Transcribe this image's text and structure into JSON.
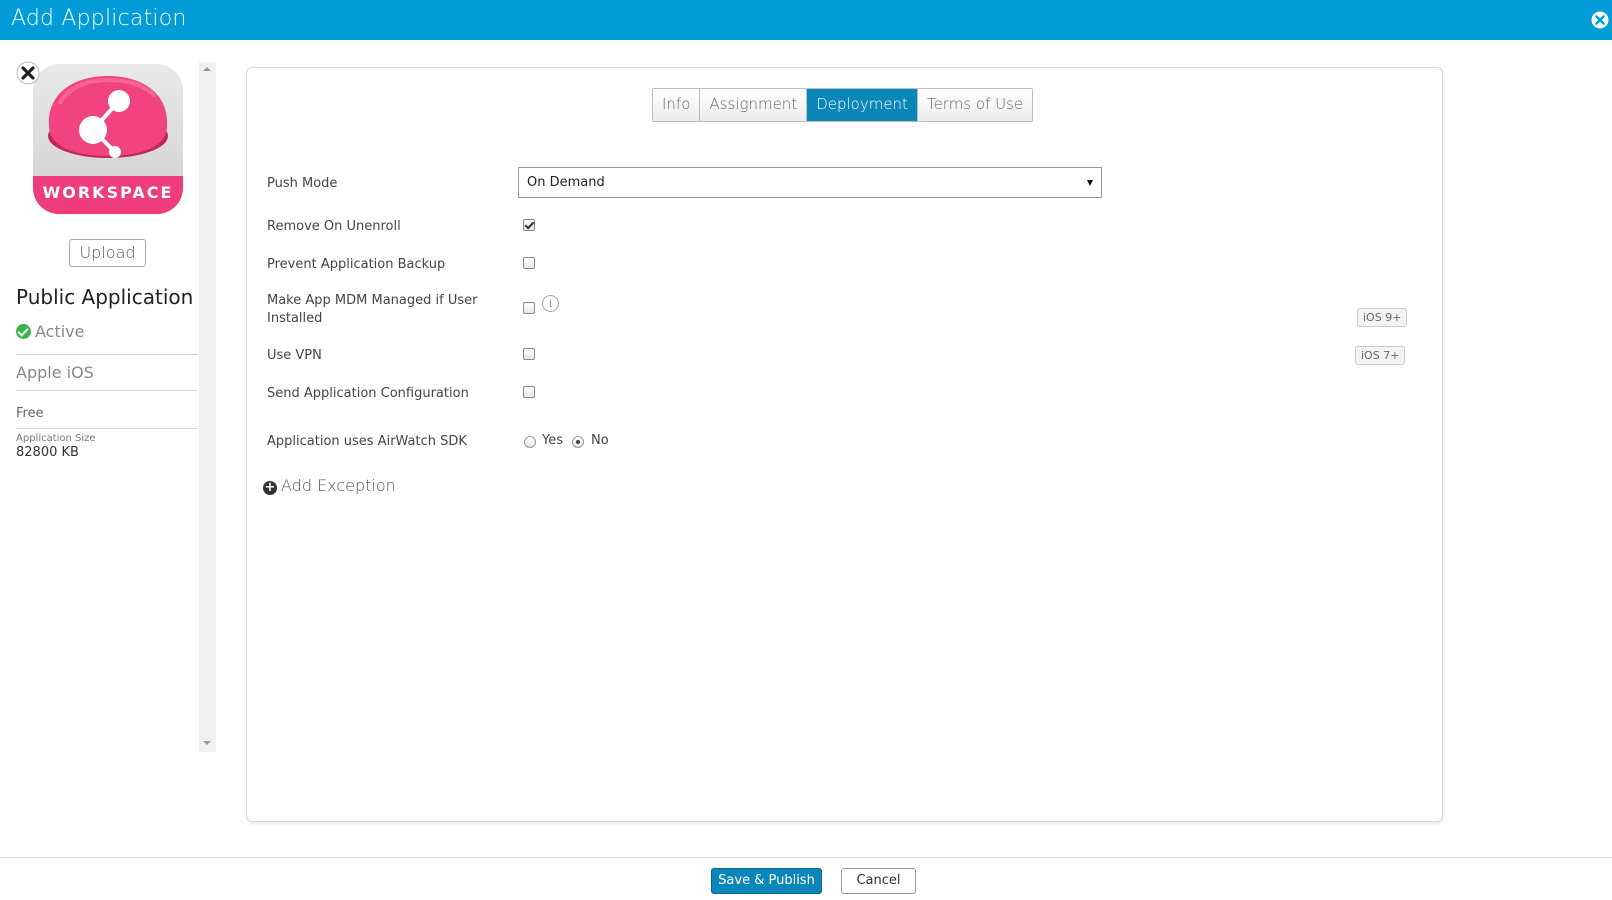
{
  "window": {
    "title": "Add Application",
    "accent_color": "#009cd8",
    "close_icon": "close-circle-icon"
  },
  "sidebar": {
    "app_icon_text": "WORKSPACE",
    "remove_icon": "remove-icon",
    "upload_label": "Upload",
    "app_type": "Public Application",
    "status": "Active",
    "status_color": "#3cb34a",
    "platform": "Apple iOS",
    "price": "Free",
    "size_label": "Application Size",
    "size_value": "82800 KB"
  },
  "tabs": [
    {
      "label": "Info",
      "active": false
    },
    {
      "label": "Assignment",
      "active": false
    },
    {
      "label": "Deployment",
      "active": true
    },
    {
      "label": "Terms of Use",
      "active": false
    }
  ],
  "form": {
    "push_mode": {
      "label": "Push Mode",
      "value": "On Demand"
    },
    "remove_on_unenroll": {
      "label": "Remove On Unenroll",
      "checked": true
    },
    "prevent_backup": {
      "label": "Prevent Application Backup",
      "checked": false
    },
    "mdm_managed": {
      "label_line1": "Make App MDM Managed if User",
      "label_line2": "Installed",
      "checked": false,
      "badge": "iOS 9+"
    },
    "use_vpn": {
      "label": "Use VPN",
      "checked": false,
      "badge": "iOS 7+"
    },
    "send_config": {
      "label": "Send Application Configuration",
      "checked": false
    },
    "airwatch_sdk": {
      "label": "Application uses AirWatch SDK",
      "options": [
        "Yes",
        "No"
      ],
      "selected": "No"
    },
    "add_exception": "Add Exception"
  },
  "footer": {
    "save_label": "Save & Publish",
    "cancel_label": "Cancel",
    "primary_color": "#0b86b8"
  }
}
